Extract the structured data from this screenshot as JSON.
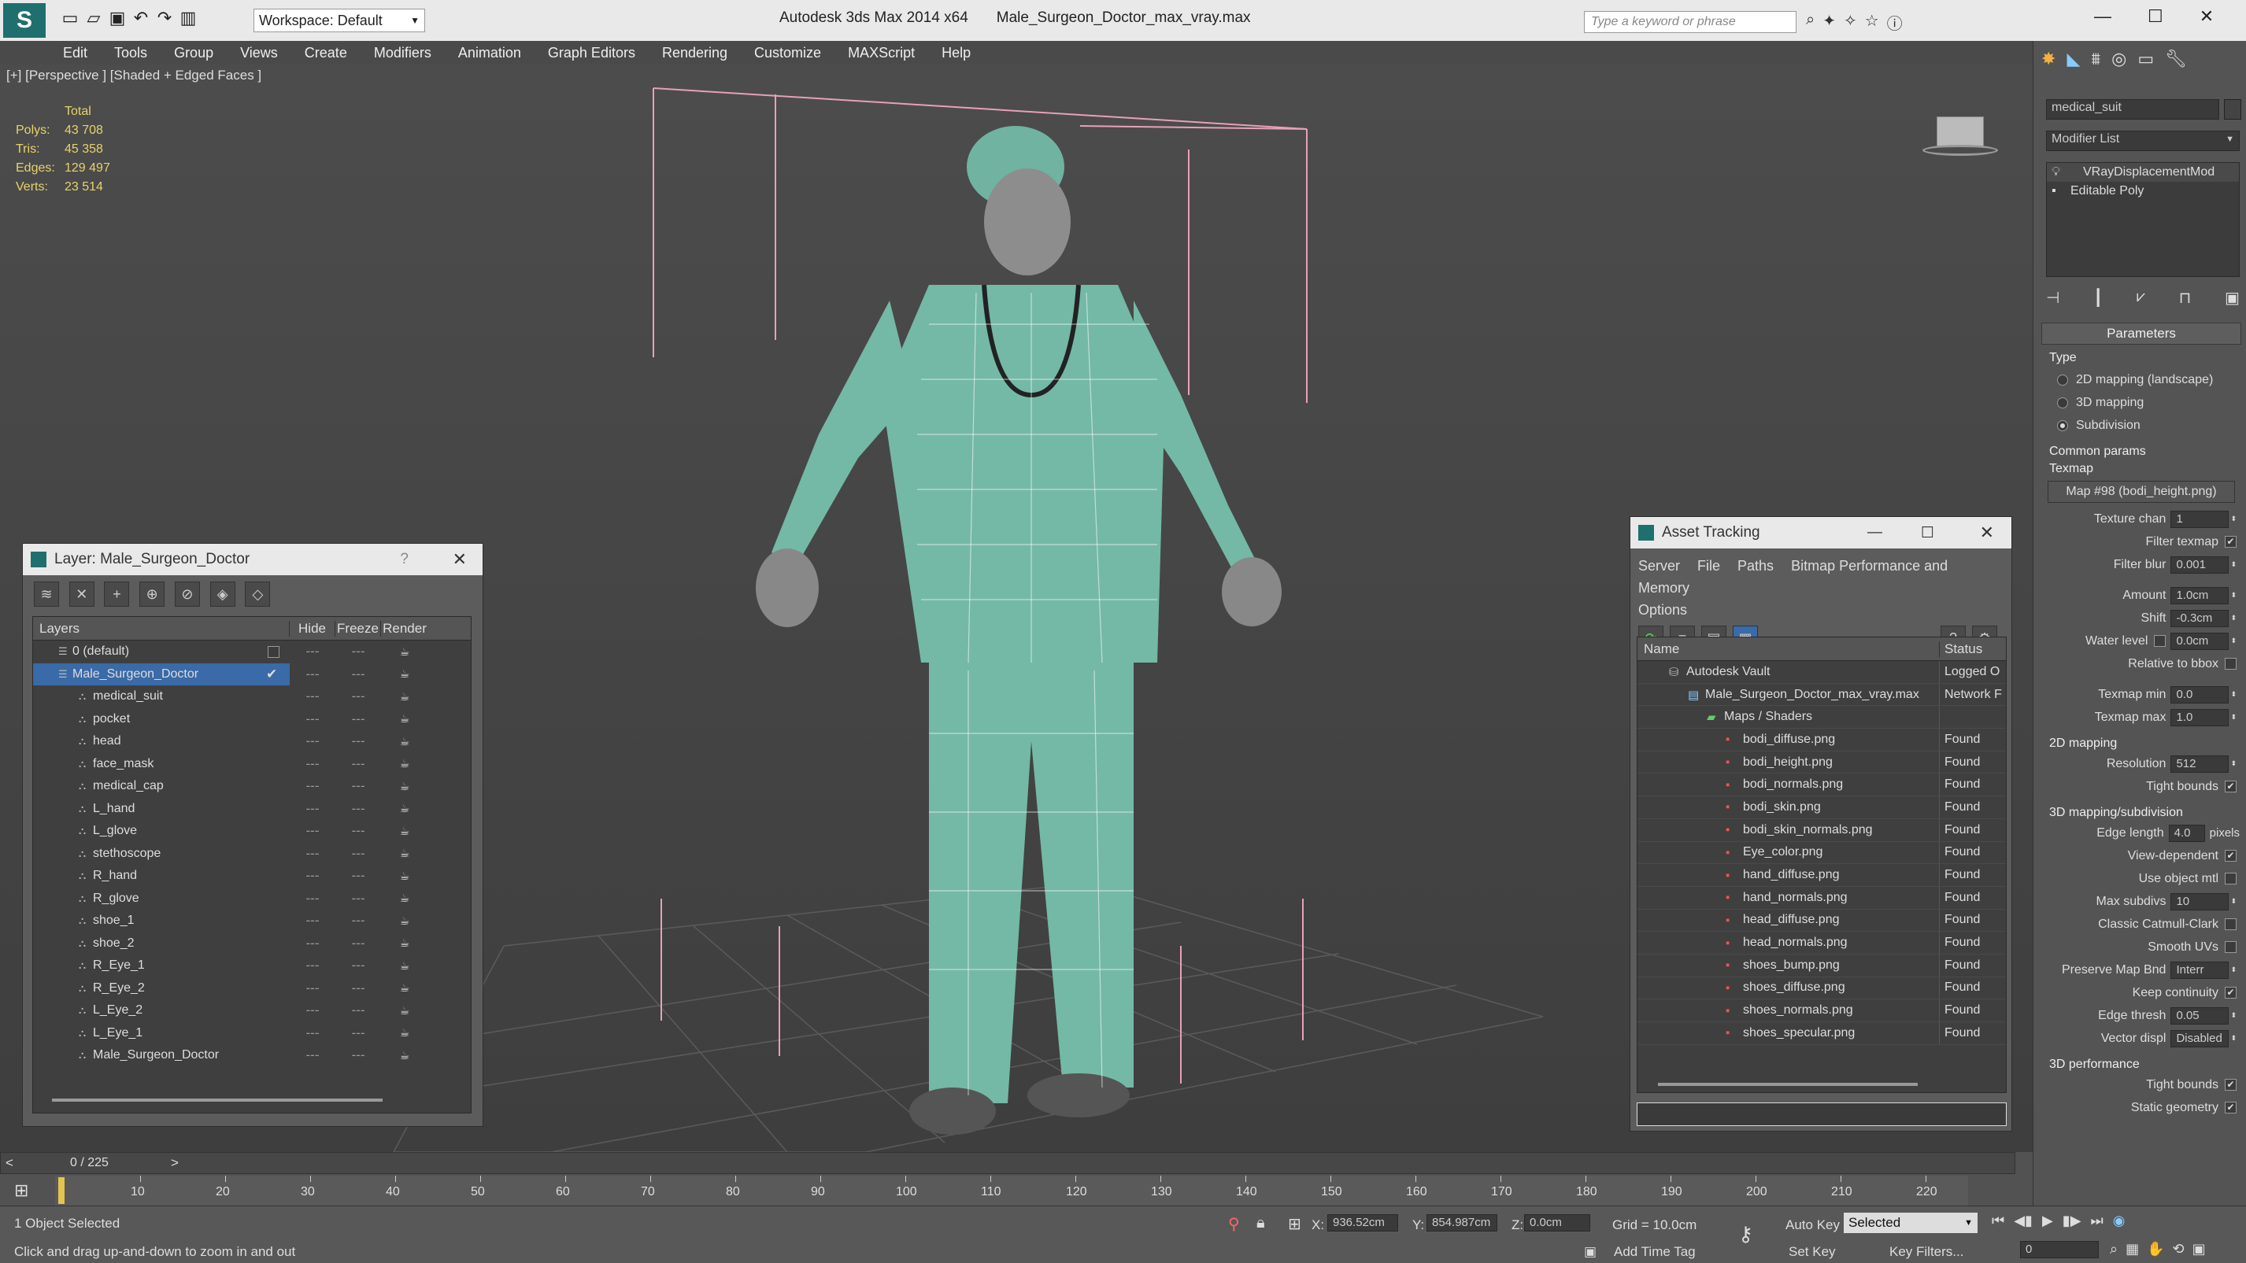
{
  "app": {
    "title": "Autodesk 3ds Max  2014 x64",
    "file": "Male_Surgeon_Doctor_max_vray.max",
    "workspace": "Workspace: Default",
    "search_placeholder": "Type a keyword or phrase"
  },
  "menu": [
    "Edit",
    "Tools",
    "Group",
    "Views",
    "Create",
    "Modifiers",
    "Animation",
    "Graph Editors",
    "Rendering",
    "Customize",
    "MAXScript",
    "Help"
  ],
  "viewport": {
    "label": "[+] [Perspective ] [Shaded + Edged Faces ]",
    "stats": {
      "total": "Total",
      "rows": [
        {
          "k": "Polys:",
          "v": "43 708"
        },
        {
          "k": "Tris:",
          "v": "45 358"
        },
        {
          "k": "Edges:",
          "v": "129 497"
        },
        {
          "k": "Verts:",
          "v": "23 514"
        }
      ]
    }
  },
  "layers": {
    "title": "Layer: Male_Surgeon_Doctor",
    "help": "?",
    "cols": [
      "Layers",
      "Hide",
      "Freeze",
      "Render"
    ],
    "items": [
      {
        "name": "0 (default)",
        "indent": 0,
        "kind": "layer"
      },
      {
        "name": "Male_Surgeon_Doctor",
        "indent": 0,
        "kind": "layer",
        "selected": true
      },
      {
        "name": "medical_suit",
        "indent": 1
      },
      {
        "name": "pocket",
        "indent": 1
      },
      {
        "name": "head",
        "indent": 1
      },
      {
        "name": "face_mask",
        "indent": 1
      },
      {
        "name": "medical_cap",
        "indent": 1
      },
      {
        "name": "L_hand",
        "indent": 1
      },
      {
        "name": "L_glove",
        "indent": 1
      },
      {
        "name": "stethoscope",
        "indent": 1
      },
      {
        "name": "R_hand",
        "indent": 1
      },
      {
        "name": "R_glove",
        "indent": 1
      },
      {
        "name": "shoe_1",
        "indent": 1
      },
      {
        "name": "shoe_2",
        "indent": 1
      },
      {
        "name": "R_Eye_1",
        "indent": 1
      },
      {
        "name": "R_Eye_2",
        "indent": 1
      },
      {
        "name": "L_Eye_2",
        "indent": 1
      },
      {
        "name": "L_Eye_1",
        "indent": 1
      },
      {
        "name": "Male_Surgeon_Doctor",
        "indent": 1
      }
    ]
  },
  "assets": {
    "title": "Asset Tracking",
    "menu": [
      "Server",
      "File",
      "Paths",
      "Bitmap Performance and Memory"
    ],
    "menu2": "Options",
    "cols": [
      "Name",
      "Status"
    ],
    "rows": [
      {
        "name": "Autodesk Vault",
        "status": "Logged O",
        "indent": 0,
        "kind": "vault"
      },
      {
        "name": "Male_Surgeon_Doctor_max_vray.max",
        "status": "Network F",
        "indent": 1,
        "kind": "max"
      },
      {
        "name": "Maps / Shaders",
        "status": "",
        "indent": 2,
        "kind": "folder"
      },
      {
        "name": "bodi_diffuse.png",
        "status": "Found",
        "indent": 3,
        "kind": "png"
      },
      {
        "name": "bodi_height.png",
        "status": "Found",
        "indent": 3,
        "kind": "png"
      },
      {
        "name": "bodi_normals.png",
        "status": "Found",
        "indent": 3,
        "kind": "png"
      },
      {
        "name": "bodi_skin.png",
        "status": "Found",
        "indent": 3,
        "kind": "png"
      },
      {
        "name": "bodi_skin_normals.png",
        "status": "Found",
        "indent": 3,
        "kind": "png"
      },
      {
        "name": "Eye_color.png",
        "status": "Found",
        "indent": 3,
        "kind": "png"
      },
      {
        "name": "hand_diffuse.png",
        "status": "Found",
        "indent": 3,
        "kind": "png"
      },
      {
        "name": "hand_normals.png",
        "status": "Found",
        "indent": 3,
        "kind": "png"
      },
      {
        "name": "head_diffuse.png",
        "status": "Found",
        "indent": 3,
        "kind": "png"
      },
      {
        "name": "head_normals.png",
        "status": "Found",
        "indent": 3,
        "kind": "png"
      },
      {
        "name": "shoes_bump.png",
        "status": "Found",
        "indent": 3,
        "kind": "png"
      },
      {
        "name": "shoes_diffuse.png",
        "status": "Found",
        "indent": 3,
        "kind": "png"
      },
      {
        "name": "shoes_normals.png",
        "status": "Found",
        "indent": 3,
        "kind": "png"
      },
      {
        "name": "shoes_specular.png",
        "status": "Found",
        "indent": 3,
        "kind": "png"
      }
    ]
  },
  "cmd": {
    "object": "medical_suit",
    "modlist": "Modifier List",
    "stack": [
      "VRayDisplacementMod",
      "Editable Poly"
    ],
    "params_title": "Parameters",
    "type_label": "Type",
    "types": [
      "2D mapping (landscape)",
      "3D mapping",
      "Subdivision"
    ],
    "type_selected": 2,
    "common": "Common params",
    "texmap": "Texmap",
    "texmap_btn": "Map #98 (bodi_height.png)",
    "fields1": [
      {
        "label": "Texture chan",
        "value": "1"
      },
      {
        "label": "Filter texmap",
        "check": true
      },
      {
        "label": "Filter blur",
        "value": "0.001"
      }
    ],
    "fields2": [
      {
        "label": "Amount",
        "value": "1.0cm"
      },
      {
        "label": "Shift",
        "value": "-0.3cm"
      },
      {
        "label": "Water level",
        "value": "0.0cm",
        "check": false
      },
      {
        "label": "Relative to bbox",
        "check": false
      }
    ],
    "fields3": [
      {
        "label": "Texmap min",
        "value": "0.0"
      },
      {
        "label": "Texmap max",
        "value": "1.0"
      }
    ],
    "mapping2d": "2D mapping",
    "fields4": [
      {
        "label": "Resolution",
        "value": "512"
      },
      {
        "label": "Tight bounds",
        "check": true
      }
    ],
    "mapping3d": "3D mapping/subdivision",
    "edge_label": "Edge length",
    "edge_value": "4.0",
    "edge_unit": "pixels",
    "fields5": [
      {
        "label": "View-dependent",
        "check": true
      },
      {
        "label": "Use object mtl",
        "check": false
      },
      {
        "label": "Max subdivs",
        "value": "10"
      },
      {
        "label": "Classic Catmull-Clark",
        "check": false
      },
      {
        "label": "Smooth UVs",
        "check": false
      },
      {
        "label": "Preserve Map Bnd",
        "value": "Interr"
      },
      {
        "label": "Keep continuity",
        "check": true
      },
      {
        "label": "Edge thresh",
        "value": "0.05"
      },
      {
        "label": "Vector displ",
        "value": "Disabled"
      }
    ],
    "perf": "3D performance",
    "fields6": [
      {
        "label": "Tight bounds",
        "check": true
      },
      {
        "label": "Static geometry",
        "check": true
      }
    ]
  },
  "timeline": {
    "frame": "0 / 225",
    "ticks": [
      "10",
      "20",
      "30",
      "40",
      "50",
      "60",
      "70",
      "80",
      "90",
      "100",
      "110",
      "120",
      "130",
      "140",
      "150",
      "160",
      "170",
      "180",
      "190",
      "200",
      "210",
      "220"
    ]
  },
  "status": {
    "selected": "1 Object Selected",
    "hint": "Click and drag up-and-down to zoom in and out",
    "x_label": "X:",
    "x": "936.52cm",
    "y_label": "Y:",
    "y": "854.987cm",
    "z_label": "Z:",
    "z": "0.0cm",
    "grid": "Grid = 10.0cm",
    "autokey": "Auto Key",
    "setkey": "Set Key",
    "sel_mode": "Selected",
    "keyfilters": "Key Filters...",
    "addtime": "Add Time Tag",
    "frame_field": "0"
  }
}
